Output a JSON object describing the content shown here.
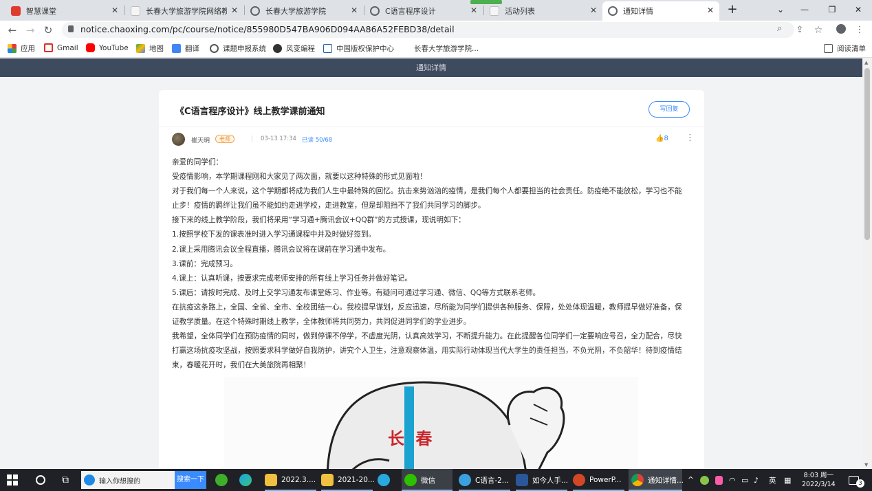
{
  "tabs": [
    {
      "label": "智慧课堂",
      "icon": "app-red-icon",
      "color": "#e03a2f"
    },
    {
      "label": "长春大学旅游学院网络教学",
      "icon": "page-icon",
      "color": "#f5f5f5"
    },
    {
      "label": "长春大学旅游学院",
      "icon": "globe-icon",
      "color": "#5f6368"
    },
    {
      "label": "C语言程序设计",
      "icon": "globe-icon",
      "color": "#5f6368"
    },
    {
      "label": "活动列表",
      "icon": "page-icon",
      "color": "#f5f5f5"
    },
    {
      "label": "通知详情",
      "icon": "globe-icon",
      "color": "#5f6368"
    }
  ],
  "address": {
    "url": "notice.chaoxing.com/pc/course/notice/855980D547BA906D094AA86A52FEBD38/detail"
  },
  "bookmarks": [
    "应用",
    "Gmail",
    "YouTube",
    "地图",
    "翻译",
    "课题申报系统",
    "风变编程",
    "中国版权保护中心",
    "长春大学旅游学院..."
  ],
  "reading_list": "阅读清单",
  "site_header": "通知详情",
  "notice": {
    "title": "《C语言程序设计》线上教学课前通知",
    "reply_button": "写回复",
    "author": "崔天明",
    "role": "老师",
    "time": "03-13 17:34",
    "read_status": "已读 50/68",
    "likes": "8",
    "paragraphs": [
      "亲爱的同学们：",
      "受疫情影响，本学期课程刚和大家见了两次面，就要以这种特殊的形式见面啦！",
      "对于我们每一个人来说，这个学期都将成为我们人生中最特殊的回忆。抗击来势汹汹的疫情，是我们每个人都要担当的社会责任。防疫绝不能放松，学习也不能止步！疫情的羁绊让我们虽不能如约走进学校，走进教室，但是却阻挡不了我们共同学习的脚步。",
      "接下来的线上教学阶段，我们将采用“学习通+腾讯会议+QQ群”的方式授课，现说明如下：",
      "1.按照学校下发的课表准时进入学习通课程中并及时做好签到。",
      "2.课上采用腾讯会议全程直播，腾讯会议将在课前在学习通中发布。",
      "3.课前：完成预习。",
      "4.课上：认真听课，按要求完成老师安排的所有线上学习任务并做好笔记。",
      "5.课后：请按时完成、及时上交学习通发布课堂练习、作业等。有疑问可通过学习通、微信、QQ等方式联系老师。",
      "在抗疫这条路上，全国、全省、全市、全校团结一心。我校提早谋划，反应迅速，尽所能为同学们提供各种服务、保障，处处体现温暖，教师提早做好准备，保证教学质量。在这个特殊时期线上教学，全体教师将共同努力，共同促进同学们的学业进步。",
      "我希望，全体同学们在预防疫情的同时，做到停课不停学，不虚度光阴，认真高效学习，不断提升能力。在此提醒各位同学们一定要响应号召，全力配合，尽快打赢这场抗疫攻坚战，按照要求科学做好自我防护，讲究个人卫生，注意观察体温，用实际行动体现当代大学生的责任担当，不负光阴，不负韶华！待到疫情结束，春暖花开时，我们在大美旅院再相聚！"
    ],
    "image_text": "长 春"
  },
  "taskbar": {
    "search_placeholder": "输入你想搜的",
    "search_button": "搜索一下",
    "items": [
      "2022.3....",
      "2021-20...",
      "微信",
      "C语言-2...",
      "如今人手...",
      "PowerP...",
      "通知详情..."
    ],
    "ime": "英",
    "clock_time": "8:03 周一",
    "clock_date": "2022/3/14",
    "notif_count": "3"
  }
}
